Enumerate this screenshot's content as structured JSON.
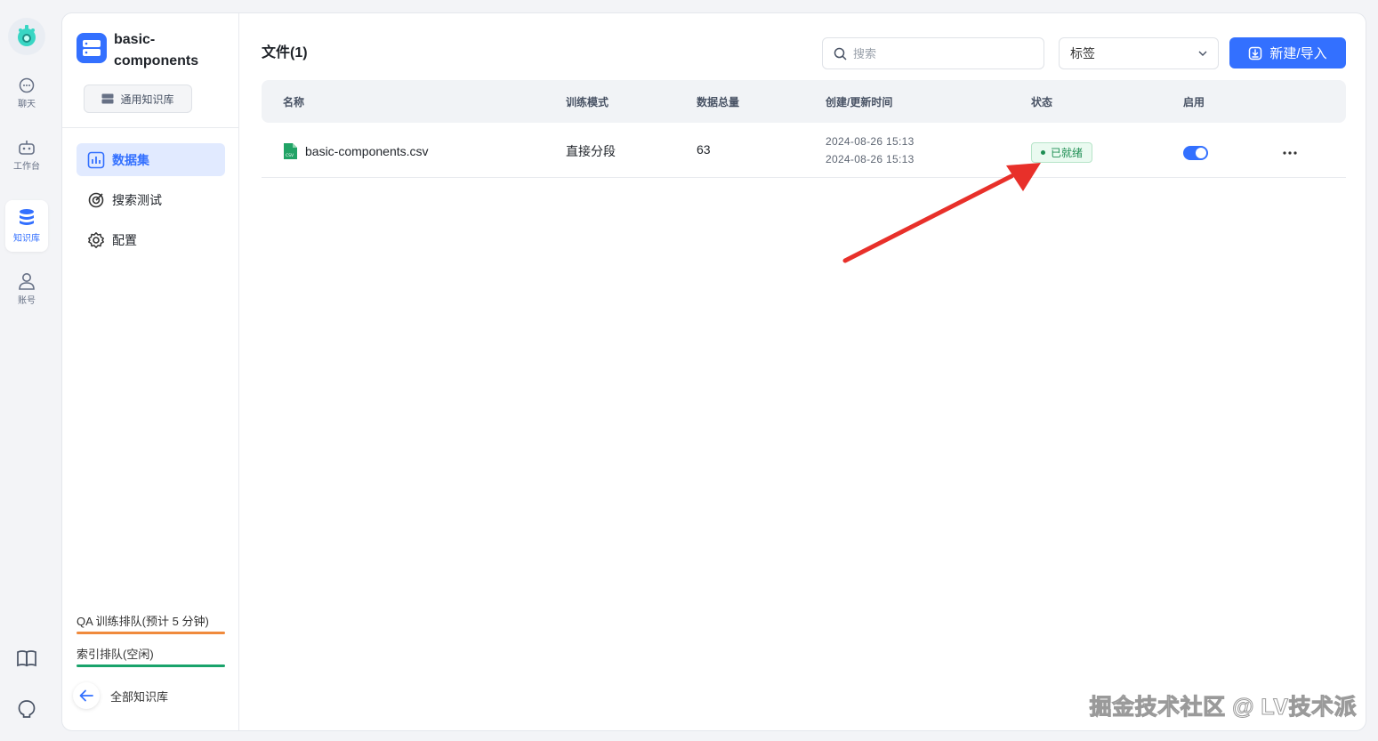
{
  "nav": {
    "items": [
      {
        "label": "聊天",
        "icon": "chat-icon"
      },
      {
        "label": "工作台",
        "icon": "robot-icon"
      },
      {
        "label": "知识库",
        "icon": "database-icon"
      },
      {
        "label": "账号",
        "icon": "user-icon"
      }
    ],
    "bottom_icons": [
      "book-icon",
      "github-icon"
    ]
  },
  "sidebar": {
    "kb_name": "basic-components",
    "kb_type": "通用知识库",
    "menu": [
      {
        "label": "数据集",
        "icon": "chart-icon"
      },
      {
        "label": "搜索测试",
        "icon": "target-icon"
      },
      {
        "label": "配置",
        "icon": "gear-icon"
      }
    ],
    "qa_queue": "QA 训练排队(预计 5 分钟)",
    "index_queue": "索引排队(空闲)",
    "back_label": "全部知识库"
  },
  "main": {
    "title": "文件(1)",
    "search_placeholder": "搜索",
    "tag_select": "标签",
    "new_button": "新建/导入",
    "columns": [
      "名称",
      "训练模式",
      "数据总量",
      "创建/更新时间",
      "状态",
      "启用"
    ],
    "rows": [
      {
        "name": "basic-components.csv",
        "mode": "直接分段",
        "count": "63",
        "created": "2024-08-26 15:13",
        "updated": "2024-08-26 15:13",
        "status": "已就绪",
        "enabled": true
      }
    ]
  },
  "watermark": "掘金技术社区 @ LV技术派",
  "colors": {
    "accent": "#3370ff",
    "status_green": "#1e8e53",
    "qa_bar": "#f08a3c",
    "index_bar": "#1aa36b",
    "arrow": "#e8302a"
  }
}
